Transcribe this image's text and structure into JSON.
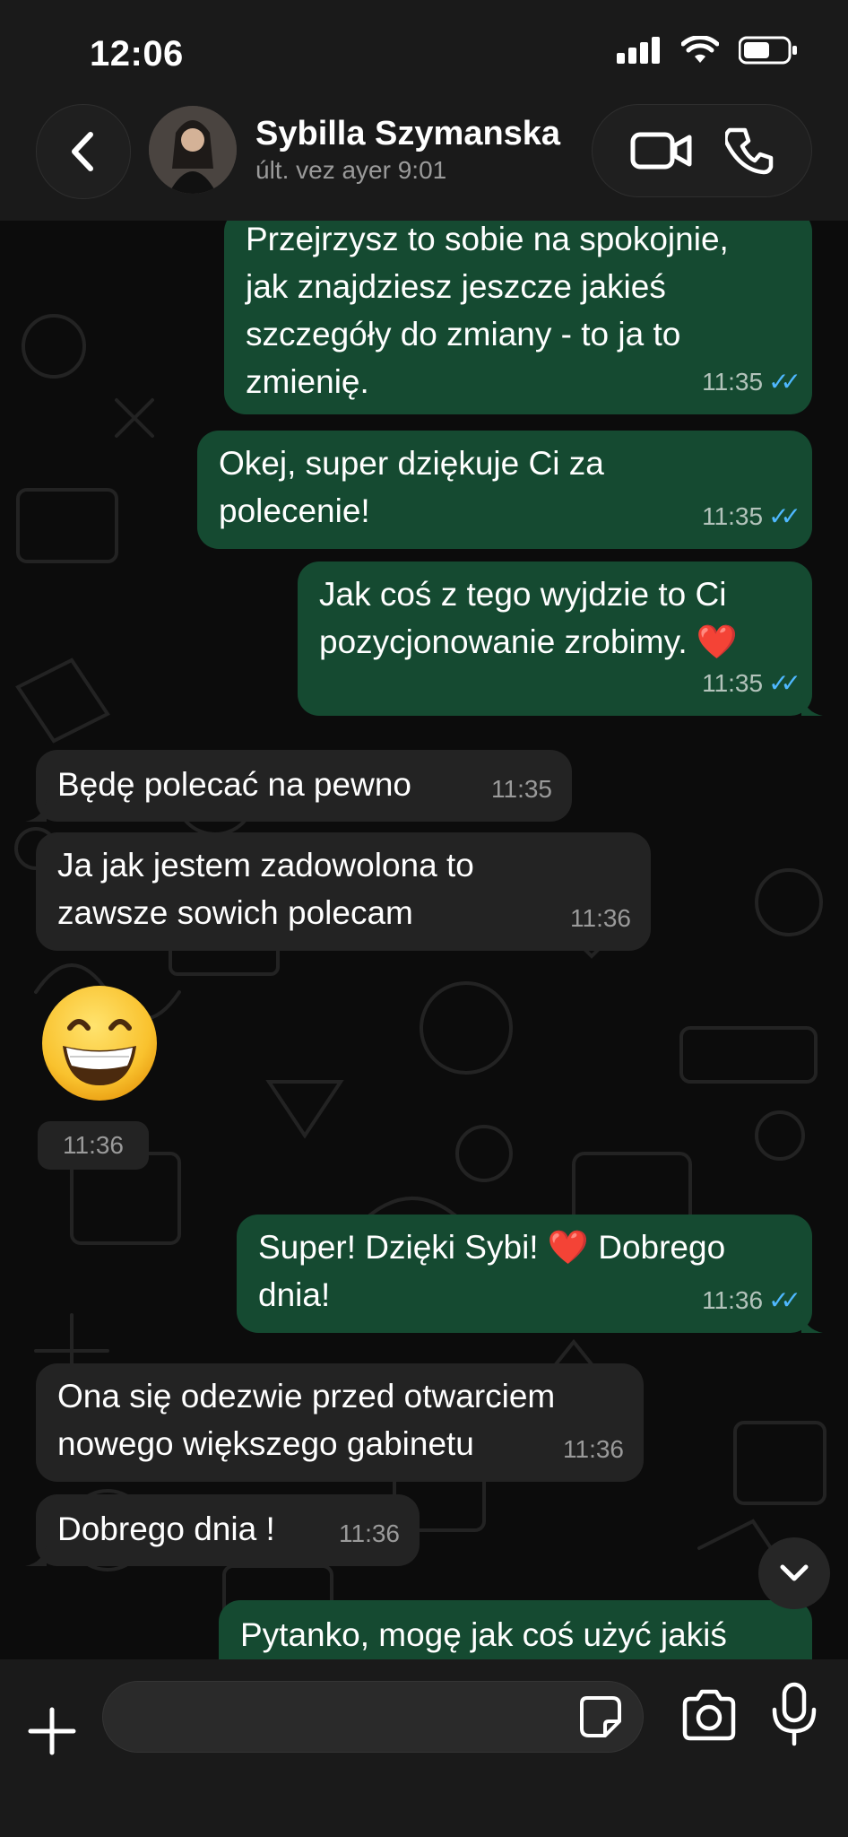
{
  "status_bar": {
    "time": "12:06"
  },
  "header": {
    "contact_name": "Sybilla Szymanska",
    "last_seen": "últ. vez ayer 9:01",
    "icons": [
      "back-icon",
      "video-call-icon",
      "voice-call-icon"
    ]
  },
  "messages": [
    {
      "dir": "out",
      "text": "Przejrzysz to sobie na spokojnie,\njak znajdziesz jeszcze jakieś\nszczegóły do zmiany - to ja to\nzmienię.",
      "time": "11:35",
      "read": true
    },
    {
      "dir": "out",
      "text": "Okej, super dziękuje Ci za\npolecenie!",
      "time": "11:35",
      "read": true
    },
    {
      "dir": "out",
      "text": "Jak coś z tego wyjdzie to Ci\npozycjonowanie zrobimy.",
      "emoji": "❤️",
      "time": "11:35",
      "read": true
    },
    {
      "dir": "in",
      "text": "Będę polecać na pewno",
      "time": "11:35"
    },
    {
      "dir": "in",
      "text": "Ja jak jestem zadowolona to\nzawsze sowich polecam",
      "time": "11:36"
    },
    {
      "dir": "in",
      "type": "emoji",
      "emoji": "😁",
      "time": "11:36"
    },
    {
      "dir": "out",
      "text_before": "Super! Dzięki Sybi!",
      "emoji": "❤️",
      "text_after": "Dobrego\ndnia!",
      "time": "11:36",
      "read": true
    },
    {
      "dir": "in",
      "text": "Ona się odezwie przed otwarciem\nnowego większego gabinetu",
      "time": "11:36"
    },
    {
      "dir": "in",
      "text": "Dobrego dnia !",
      "time": "11:36"
    },
    {
      "dir": "out",
      "text": "Pytanko, mogę jak coś użyć jakiś",
      "partial": true
    }
  ],
  "composer": {
    "placeholder": "",
    "icons": [
      "plus-icon",
      "sticker-icon",
      "camera-icon",
      "microphone-icon"
    ]
  },
  "colors": {
    "outgoing": "#154a31",
    "incoming": "#232323",
    "read_ticks": "#4fb8ff",
    "background": "#0c0c0c"
  }
}
